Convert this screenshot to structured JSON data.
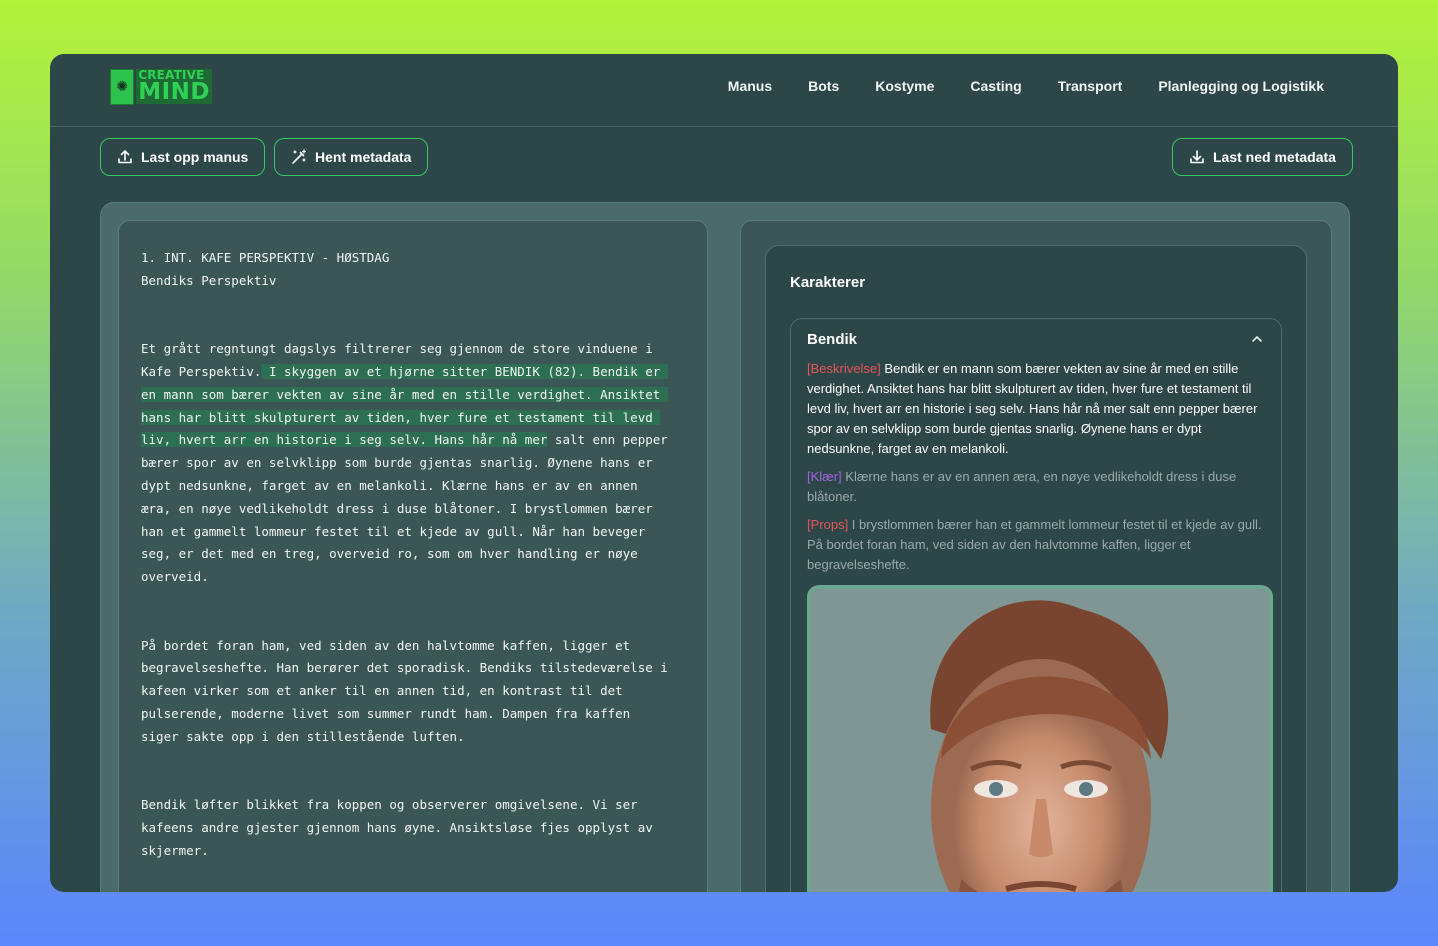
{
  "app": {
    "logo_top": "CREATIVE",
    "logo_bottom": "MIND"
  },
  "nav": {
    "items": [
      {
        "label": "Manus"
      },
      {
        "label": "Bots"
      },
      {
        "label": "Kostyme"
      },
      {
        "label": "Casting"
      },
      {
        "label": "Transport"
      },
      {
        "label": "Planlegging og Logistikk"
      }
    ]
  },
  "toolbar": {
    "upload_label": "Last opp manus",
    "fetch_label": "Hent metadata",
    "download_label": "Last ned metadata"
  },
  "script": {
    "heading": "1. INT. KAFE PERSPEKTIV - HØSTDAG",
    "subheading": "Bendiks Perspektiv",
    "p1_a": "Et grått regntungt dagslys filtrerer seg gjennom de store vinduene i\nKafe Perspektiv.",
    "p1_hl": " I skyggen av et hjørne sitter BENDIK (82). Bendik er \nen mann som bærer vekten av sine år med en stille verdighet. Ansiktet \nhans har blitt skulpturert av tiden, hver fure et testament til levd \nliv, hvert arr en historie i seg selv. Hans hår nå mer",
    "p1_b": " salt enn pepper\nbærer spor av en selvklipp som burde gjentas snarlig. Øynene hans er\ndypt nedsunkne, farget av en melankoli. Klærne hans er av en annen\næra, en nøye vedlikeholdt dress i duse blåtoner. I brystlommen bærer\nhan et gammelt lommeur festet til et kjede av gull. Når han beveger\nseg, er det med en treg, overveid ro, som om hver handling er nøye\noverveid.",
    "p2": "På bordet foran ham, ved siden av den halvtomme kaffen, ligger et\nbegravelseshefte. Han berører det sporadisk. Bendiks tilstedeværelse i\nkafeen virker som et anker til en annen tid, en kontrast til det\npulserende, moderne livet som summer rundt ham. Dampen fra kaffen\nsiger sakte opp i den stillestående luften.",
    "p3": "Bendik løfter blikket fra koppen og observerer omgivelsene. Vi ser\nkafeens andre gjester gjennom hans øyne. Ansiktsløse fjes opplyst av\nskjermer."
  },
  "characters": {
    "title": "Karakterer",
    "items": [
      {
        "name": "Bendik",
        "desc_tag": "[Beskrivelse]",
        "desc": " Bendik er en mann som bærer vekten av sine år med en stille verdighet. Ansiktet hans har blitt skulpturert av tiden, hver fure et testament til levd liv, hvert arr en historie i seg selv. Hans hår nå mer salt enn pepper bærer spor av en selvklipp som burde gjentas snarlig. Øynene hans er dypt nedsunkne, farget av en melankoli.",
        "klaer_tag": "[Klær]",
        "klaer": " Klærne hans er av en annen æra, en nøye vedlikeholdt dress i duse blåtoner.",
        "props_tag": "[Props]",
        "props": " I brystlommen bærer han et gammelt lommeur festet til et kjede av gull. På bordet foran ham, ved siden av den halvtomme kaffen, ligger et begravelseshefte."
      }
    ]
  },
  "colors": {
    "accent": "#33c863",
    "panel": "#2d4647",
    "highlight": "#2d6f52"
  }
}
